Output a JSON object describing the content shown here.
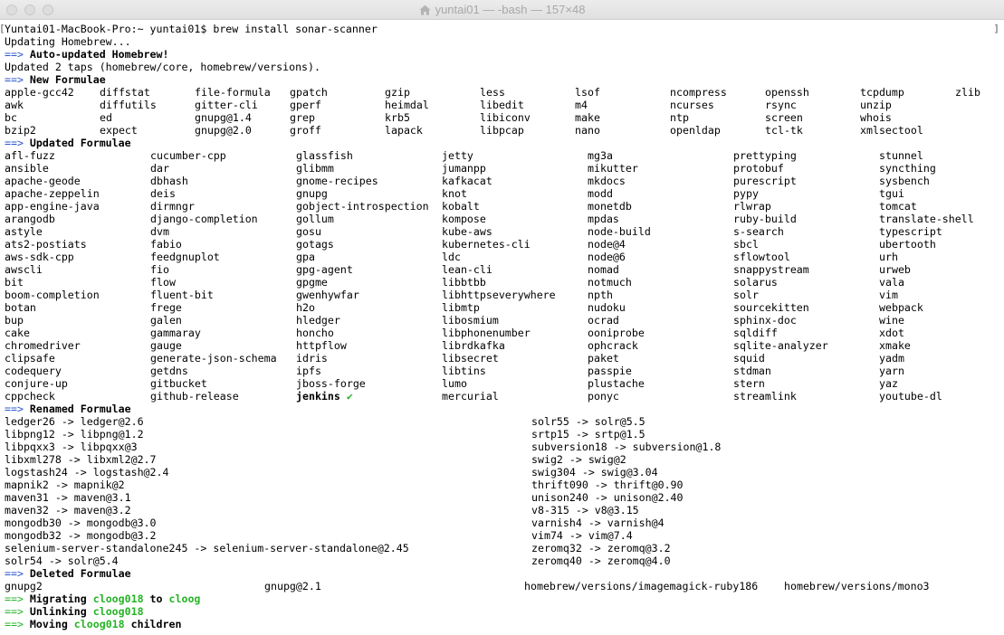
{
  "window": {
    "title": "yuntai01 — -bash — 157×48",
    "title_icon": "house-icon"
  },
  "colors": {
    "background": "#ffffff",
    "text": "#000000",
    "arrow_blue": "#2b56d1",
    "success_green": "#26b426",
    "title_text": "#a8a8a8",
    "titlebar_top": "#ececec",
    "titlebar_bottom": "#e0e0e0"
  },
  "terminal": {
    "marks": {
      "start": "[",
      "end": "]"
    },
    "prompt": "Yuntai01-MacBook-Pro:~ yuntai01$ ",
    "command": "brew install sonar-scanner",
    "updating": "Updating Homebrew...",
    "auto_updated": {
      "arrow": "==>",
      "text": "Auto-updated Homebrew!"
    },
    "updated_taps": "Updated 2 taps (homebrew/core, homebrew/versions).",
    "new_formulae": {
      "arrow": "==>",
      "heading": "New Formulae",
      "rows": [
        [
          "apple-gcc42",
          "diffstat",
          "file-formula",
          "gpatch",
          "gzip",
          "less",
          "lsof",
          "ncompress",
          "openssh",
          "tcpdump",
          "zlib"
        ],
        [
          "awk",
          "diffutils",
          "gitter-cli",
          "gperf",
          "heimdal",
          "libedit",
          "m4",
          "ncurses",
          "rsync",
          "unzip"
        ],
        [
          "bc",
          "ed",
          "gnupg@1.4",
          "grep",
          "krb5",
          "libiconv",
          "make",
          "ntp",
          "screen",
          "whois"
        ],
        [
          "bzip2",
          "expect",
          "gnupg@2.0",
          "groff",
          "lapack",
          "libpcap",
          "nano",
          "openldap",
          "tcl-tk",
          "xmlsectool"
        ]
      ]
    },
    "updated_formulae": {
      "arrow": "==>",
      "heading": "Updated Formulae",
      "rows": [
        [
          "afl-fuzz",
          "cucumber-cpp",
          "glassfish",
          "jetty",
          "mg3a",
          "prettyping",
          "stunnel"
        ],
        [
          "ansible",
          "dar",
          "glibmm",
          "jumanpp",
          "mikutter",
          "protobuf",
          "syncthing"
        ],
        [
          "apache-geode",
          "dbhash",
          "gnome-recipes",
          "kafkacat",
          "mkdocs",
          "purescript",
          "sysbench"
        ],
        [
          "apache-zeppelin",
          "deis",
          "gnupg",
          "knot",
          "modd",
          "pypy",
          "tgui"
        ],
        [
          "app-engine-java",
          "dirmngr",
          "gobject-introspection",
          "kobalt",
          "monetdb",
          "rlwrap",
          "tomcat"
        ],
        [
          "arangodb",
          "django-completion",
          "gollum",
          "kompose",
          "mpdas",
          "ruby-build",
          "translate-shell"
        ],
        [
          "astyle",
          "dvm",
          "gosu",
          "kube-aws",
          "node-build",
          "s-search",
          "typescript"
        ],
        [
          "ats2-postiats",
          "fabio",
          "gotags",
          "kubernetes-cli",
          "node@4",
          "sbcl",
          "ubertooth"
        ],
        [
          "aws-sdk-cpp",
          "feedgnuplot",
          "gpa",
          "ldc",
          "node@6",
          "sflowtool",
          "urh"
        ],
        [
          "awscli",
          "fio",
          "gpg-agent",
          "lean-cli",
          "nomad",
          "snappystream",
          "urweb"
        ],
        [
          "bit",
          "flow",
          "gpgme",
          "libbtbb",
          "notmuch",
          "solarus",
          "vala"
        ],
        [
          "boom-completion",
          "fluent-bit",
          "gwenhywfar",
          "libhttpseverywhere",
          "npth",
          "solr",
          "vim"
        ],
        [
          "botan",
          "frege",
          "h2o",
          "libmtp",
          "nudoku",
          "sourcekitten",
          "webpack"
        ],
        [
          "bup",
          "galen",
          "hledger",
          "libosmium",
          "ocrad",
          "sphinx-doc",
          "wine"
        ],
        [
          "cake",
          "gammaray",
          "honcho",
          "libphonenumber",
          "ooniprobe",
          "sqldiff",
          "xdot"
        ],
        [
          "chromedriver",
          "gauge",
          "httpflow",
          "librdkafka",
          "ophcrack",
          "sqlite-analyzer",
          "xmake"
        ],
        [
          "clipsafe",
          "generate-json-schema",
          "idris",
          "libsecret",
          "paket",
          "squid",
          "yadm"
        ],
        [
          "codequery",
          "getdns",
          "ipfs",
          "libtins",
          "passpie",
          "stdman",
          "yarn"
        ],
        [
          "conjure-up",
          "gitbucket",
          "jboss-forge",
          "lumo",
          "plustache",
          "stern",
          "yaz"
        ],
        [
          "cppcheck",
          "github-release",
          {
            "text": "jenkins",
            "check": "✔"
          },
          "mercurial",
          "ponyc",
          "streamlink",
          "youtube-dl"
        ]
      ]
    },
    "renamed_formulae": {
      "arrow": "==>",
      "heading": "Renamed Formulae",
      "rows": [
        [
          "ledger26 -> ledger@2.6",
          "solr55 -> solr@5.5"
        ],
        [
          "libpng12 -> libpng@1.2",
          "srtp15 -> srtp@1.5"
        ],
        [
          "libpqxx3 -> libpqxx@3",
          "subversion18 -> subversion@1.8"
        ],
        [
          "libxml278 -> libxml2@2.7",
          "swig2 -> swig@2"
        ],
        [
          "logstash24 -> logstash@2.4",
          "swig304 -> swig@3.04"
        ],
        [
          "mapnik2 -> mapnik@2",
          "thrift090 -> thrift@0.90"
        ],
        [
          "maven31 -> maven@3.1",
          "unison240 -> unison@2.40"
        ],
        [
          "maven32 -> maven@3.2",
          "v8-315 -> v8@3.15"
        ],
        [
          "mongodb30 -> mongodb@3.0",
          "varnish4 -> varnish@4"
        ],
        [
          "mongodb32 -> mongodb@3.2",
          "vim74 -> vim@7.4"
        ],
        [
          "selenium-server-standalone245 -> selenium-server-standalone@2.45",
          "zeromq32 -> zeromq@3.2"
        ],
        [
          "solr54 -> solr@5.4",
          "zeromq40 -> zeromq@4.0"
        ]
      ]
    },
    "deleted_formulae": {
      "arrow": "==>",
      "heading": "Deleted Formulae",
      "rows": [
        [
          "gnupg2",
          "gnupg@2.1",
          "homebrew/versions/imagemagick-ruby186",
          "homebrew/versions/mono3"
        ]
      ]
    },
    "migration": [
      {
        "arrow": "==>",
        "segments": [
          {
            "text": "Migrating "
          },
          {
            "text": "cloog018",
            "formula": true
          },
          {
            "text": " to "
          },
          {
            "text": "cloog",
            "formula": true
          }
        ]
      },
      {
        "arrow": "==>",
        "segments": [
          {
            "text": "Unlinking "
          },
          {
            "text": "cloog018",
            "formula": true
          }
        ]
      },
      {
        "arrow": "==>",
        "segments": [
          {
            "text": "Moving "
          },
          {
            "text": "cloog018",
            "formula": true
          },
          {
            "text": " children"
          }
        ]
      }
    ]
  }
}
